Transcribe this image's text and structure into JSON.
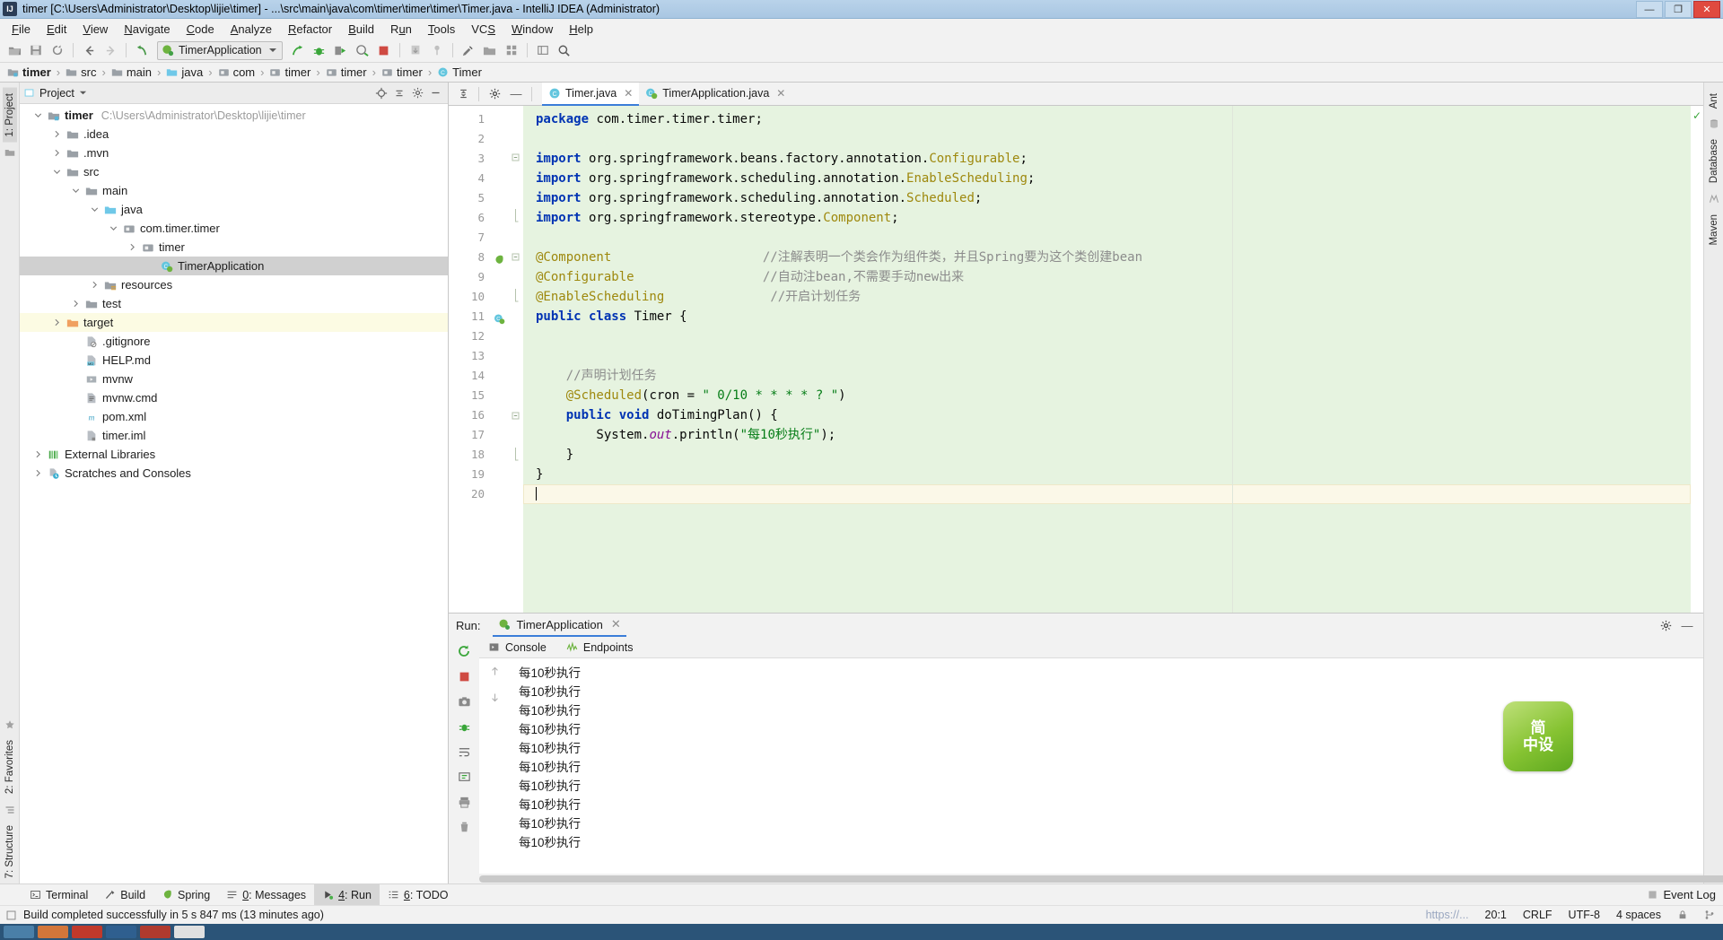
{
  "window": {
    "title": "timer [C:\\Users\\Administrator\\Desktop\\lijie\\timer] - ...\\src\\main\\java\\com\\timer\\timer\\timer\\Timer.java - IntelliJ IDEA (Administrator)",
    "app_icon_label": "IJ",
    "minimize_label": "—",
    "maximize_label": "❐",
    "close_label": "✕"
  },
  "menu": {
    "items": [
      {
        "label": "File",
        "mnemonic": "F"
      },
      {
        "label": "Edit",
        "mnemonic": "E"
      },
      {
        "label": "View",
        "mnemonic": "V"
      },
      {
        "label": "Navigate",
        "mnemonic": "N"
      },
      {
        "label": "Code",
        "mnemonic": "C"
      },
      {
        "label": "Analyze",
        "mnemonic": "A"
      },
      {
        "label": "Refactor",
        "mnemonic": "R"
      },
      {
        "label": "Build",
        "mnemonic": "B"
      },
      {
        "label": "Run",
        "mnemonic": "u"
      },
      {
        "label": "Tools",
        "mnemonic": "T"
      },
      {
        "label": "VCS",
        "mnemonic": "S"
      },
      {
        "label": "Window",
        "mnemonic": "W"
      },
      {
        "label": "Help",
        "mnemonic": "H"
      }
    ]
  },
  "toolbar": {
    "open_label": "open-folder-icon",
    "save_label": "save-icon",
    "sync_label": "sync-icon",
    "back_label": "back-arrow-icon",
    "forward_label": "forward-arrow-icon",
    "revert_label": "revert-icon",
    "run_config_name": "TimerApplication",
    "run_label": "run-icon",
    "debug_label": "debug-icon",
    "run_coverage_label": "run-with-coverage-icon",
    "profile_label": "profile-icon",
    "stop_label": "stop-icon",
    "update_project_label": "update-project-icon",
    "commit_label": "commit-icon",
    "settings_label": "settings-icon",
    "project_structure_label": "project-structure-icon",
    "search_label": "search-icon"
  },
  "breadcrumb": {
    "items": [
      {
        "label": "timer",
        "icon": "module-folder-icon",
        "bold": true
      },
      {
        "label": "src",
        "icon": "folder-icon",
        "bold": false
      },
      {
        "label": "main",
        "icon": "folder-icon",
        "bold": false
      },
      {
        "label": "java",
        "icon": "source-root-icon",
        "bold": false
      },
      {
        "label": "com",
        "icon": "package-icon",
        "bold": false
      },
      {
        "label": "timer",
        "icon": "package-icon",
        "bold": false
      },
      {
        "label": "timer",
        "icon": "package-icon",
        "bold": false
      },
      {
        "label": "timer",
        "icon": "package-icon",
        "bold": false
      },
      {
        "label": "Timer",
        "icon": "class-icon",
        "bold": false
      }
    ],
    "separator": "›"
  },
  "left_strip": {
    "project_tab": "1: Project",
    "structure_tab": "7: Structure",
    "favorites_tab": "2: Favorites"
  },
  "right_strip": {
    "ant_tab": "Ant",
    "database_tab": "Database",
    "maven_tab": "Maven"
  },
  "project_panel": {
    "title": "Project",
    "tree": [
      {
        "indent": 0,
        "arrow": "down",
        "icon": "project-folder-icon",
        "label": "timer",
        "bold": true,
        "path": "C:\\Users\\Administrator\\Desktop\\lijie\\timer",
        "state": "normal"
      },
      {
        "indent": 1,
        "arrow": "right",
        "icon": "folder-icon",
        "label": ".idea",
        "bold": false,
        "path": "",
        "state": "normal"
      },
      {
        "indent": 1,
        "arrow": "right",
        "icon": "folder-icon",
        "label": ".mvn",
        "bold": false,
        "path": "",
        "state": "normal"
      },
      {
        "indent": 1,
        "arrow": "down",
        "icon": "folder-icon",
        "label": "src",
        "bold": false,
        "path": "",
        "state": "normal"
      },
      {
        "indent": 2,
        "arrow": "down",
        "icon": "folder-icon",
        "label": "main",
        "bold": false,
        "path": "",
        "state": "normal"
      },
      {
        "indent": 3,
        "arrow": "down",
        "icon": "source-root-icon",
        "label": "java",
        "bold": false,
        "path": "",
        "state": "normal"
      },
      {
        "indent": 4,
        "arrow": "down",
        "icon": "package-icon",
        "label": "com.timer.timer",
        "bold": false,
        "path": "",
        "state": "normal"
      },
      {
        "indent": 5,
        "arrow": "right",
        "icon": "package-icon",
        "label": "timer",
        "bold": false,
        "path": "",
        "state": "normal"
      },
      {
        "indent": 6,
        "arrow": "none",
        "icon": "spring-class-icon",
        "label": "TimerApplication",
        "bold": false,
        "path": "",
        "state": "selected"
      },
      {
        "indent": 3,
        "arrow": "right",
        "icon": "resources-folder-icon",
        "label": "resources",
        "bold": false,
        "path": "",
        "state": "normal"
      },
      {
        "indent": 2,
        "arrow": "right",
        "icon": "folder-icon",
        "label": "test",
        "bold": false,
        "path": "",
        "state": "normal"
      },
      {
        "indent": 1,
        "arrow": "right",
        "icon": "target-folder-icon",
        "label": "target",
        "bold": false,
        "path": "",
        "state": "highlighted"
      },
      {
        "indent": 2,
        "arrow": "none",
        "icon": "gitignore-file-icon",
        "label": ".gitignore",
        "bold": false,
        "path": "",
        "state": "normal"
      },
      {
        "indent": 2,
        "arrow": "none",
        "icon": "markdown-file-icon",
        "label": "HELP.md",
        "bold": false,
        "path": "",
        "state": "normal"
      },
      {
        "indent": 2,
        "arrow": "none",
        "icon": "script-file-icon",
        "label": "mvnw",
        "bold": false,
        "path": "",
        "state": "normal"
      },
      {
        "indent": 2,
        "arrow": "none",
        "icon": "cmd-file-icon",
        "label": "mvnw.cmd",
        "bold": false,
        "path": "",
        "state": "normal"
      },
      {
        "indent": 2,
        "arrow": "none",
        "icon": "maven-file-icon",
        "label": "pom.xml",
        "bold": false,
        "path": "",
        "state": "normal"
      },
      {
        "indent": 2,
        "arrow": "none",
        "icon": "iml-file-icon",
        "label": "timer.iml",
        "bold": false,
        "path": "",
        "state": "normal"
      },
      {
        "indent": 0,
        "arrow": "right",
        "icon": "libraries-icon",
        "label": "External Libraries",
        "bold": false,
        "path": "",
        "state": "normal"
      },
      {
        "indent": 0,
        "arrow": "right",
        "icon": "scratches-icon",
        "label": "Scratches and Consoles",
        "bold": false,
        "path": "",
        "state": "normal"
      }
    ]
  },
  "editor": {
    "tabs": [
      {
        "label": "Timer.java",
        "icon": "java-class-icon",
        "active": true,
        "close": "✕"
      },
      {
        "label": "TimerApplication.java",
        "icon": "spring-class-icon",
        "active": false,
        "close": "✕"
      }
    ],
    "expand_all_label": "collapse-icon",
    "settings_label": "gear-icon",
    "hide_label": "—",
    "inspection_ok": "✓",
    "lines": [
      {
        "n": 1,
        "tokens": [
          {
            "t": "kw",
            "v": "package"
          },
          {
            "t": "plain",
            "v": " com.timer.timer.timer;"
          }
        ]
      },
      {
        "n": 2,
        "tokens": []
      },
      {
        "n": 3,
        "tokens": [
          {
            "t": "kw",
            "v": "import"
          },
          {
            "t": "plain",
            "v": " org.springframework.beans.factory.annotation."
          },
          {
            "t": "cls",
            "v": "Configurable"
          },
          {
            "t": "plain",
            "v": ";"
          }
        ],
        "fold": "start"
      },
      {
        "n": 4,
        "tokens": [
          {
            "t": "kw",
            "v": "import"
          },
          {
            "t": "plain",
            "v": " org.springframework.scheduling.annotation."
          },
          {
            "t": "cls",
            "v": "EnableScheduling"
          },
          {
            "t": "plain",
            "v": ";"
          }
        ]
      },
      {
        "n": 5,
        "tokens": [
          {
            "t": "kw",
            "v": "import"
          },
          {
            "t": "plain",
            "v": " org.springframework.scheduling.annotation."
          },
          {
            "t": "cls",
            "v": "Scheduled"
          },
          {
            "t": "plain",
            "v": ";"
          }
        ]
      },
      {
        "n": 6,
        "tokens": [
          {
            "t": "kw",
            "v": "import"
          },
          {
            "t": "plain",
            "v": " org.springframework.stereotype."
          },
          {
            "t": "cls",
            "v": "Component"
          },
          {
            "t": "plain",
            "v": ";"
          }
        ],
        "fold": "end"
      },
      {
        "n": 7,
        "tokens": []
      },
      {
        "n": 8,
        "tokens": [
          {
            "t": "ann",
            "v": "@Component"
          },
          {
            "t": "plain",
            "v": "                    "
          },
          {
            "t": "cmt",
            "v": "//注解表明一个类会作为组件类，并且Spring要为这个类创建bean"
          }
        ],
        "gutter": "spring-bean-icon",
        "fold": "start"
      },
      {
        "n": 9,
        "tokens": [
          {
            "t": "ann",
            "v": "@Configurable"
          },
          {
            "t": "plain",
            "v": "                 "
          },
          {
            "t": "cmt",
            "v": "//自动注bean,不需要手动new出来"
          }
        ]
      },
      {
        "n": 10,
        "tokens": [
          {
            "t": "ann",
            "v": "@EnableScheduling"
          },
          {
            "t": "plain",
            "v": "              "
          },
          {
            "t": "cmt",
            "v": "//开启计划任务"
          }
        ],
        "fold": "end"
      },
      {
        "n": 11,
        "tokens": [
          {
            "t": "kw",
            "v": "public class"
          },
          {
            "t": "plain",
            "v": " Timer {"
          }
        ],
        "gutter": "spring-class-icon"
      },
      {
        "n": 12,
        "tokens": []
      },
      {
        "n": 13,
        "tokens": []
      },
      {
        "n": 14,
        "tokens": [
          {
            "t": "plain",
            "v": "    "
          },
          {
            "t": "cmt",
            "v": "//声明计划任务"
          }
        ]
      },
      {
        "n": 15,
        "tokens": [
          {
            "t": "plain",
            "v": "    "
          },
          {
            "t": "ann",
            "v": "@Scheduled"
          },
          {
            "t": "plain",
            "v": "(cron = "
          },
          {
            "t": "str",
            "v": "\" 0/10 * * * * ? \""
          },
          {
            "t": "plain",
            "v": ")"
          }
        ]
      },
      {
        "n": 16,
        "tokens": [
          {
            "t": "plain",
            "v": "    "
          },
          {
            "t": "kw",
            "v": "public void"
          },
          {
            "t": "plain",
            "v": " doTimingPlan() {"
          }
        ],
        "fold": "start"
      },
      {
        "n": 17,
        "tokens": [
          {
            "t": "plain",
            "v": "        System."
          },
          {
            "t": "fld",
            "v": "out"
          },
          {
            "t": "plain",
            "v": ".println("
          },
          {
            "t": "str",
            "v": "\"每10秒执行\""
          },
          {
            "t": "plain",
            "v": ");"
          }
        ]
      },
      {
        "n": 18,
        "tokens": [
          {
            "t": "plain",
            "v": "    }"
          }
        ],
        "fold": "end"
      },
      {
        "n": 19,
        "tokens": [
          {
            "t": "plain",
            "v": "}"
          }
        ]
      },
      {
        "n": 20,
        "tokens": [],
        "current": true
      }
    ]
  },
  "run_window": {
    "label": "Run:",
    "tab_label": "TimerApplication",
    "tab_close": "✕",
    "settings_icon": "gear-icon",
    "hide_icon": "—",
    "subtabs": [
      {
        "label": "Console",
        "icon": "console-icon"
      },
      {
        "label": "Endpoints",
        "icon": "endpoints-icon"
      }
    ],
    "side_buttons": [
      "rerun-icon",
      "stop-icon",
      "screenshot-icon",
      "thread-dump-icon",
      "wrap-text-icon",
      "scroll-to-end-icon",
      "print-icon",
      "clear-all-icon"
    ],
    "console_lines": [
      "每10秒执行",
      "每10秒执行",
      "每10秒执行",
      "每10秒执行",
      "每10秒执行",
      "每10秒执行",
      "每10秒执行",
      "每10秒执行",
      "每10秒执行",
      "每10秒执行"
    ],
    "watermark_line1": "简",
    "watermark_line2": "中设"
  },
  "tool_window_bar": {
    "items": [
      {
        "label": "Terminal",
        "icon": "terminal-icon",
        "mnemonic": "",
        "active": false
      },
      {
        "label": "Build",
        "icon": "build-icon",
        "mnemonic": "",
        "active": false
      },
      {
        "label": "Spring",
        "icon": "spring-icon",
        "mnemonic": "",
        "active": false
      },
      {
        "label": "0: Messages",
        "icon": "messages-icon",
        "mnemonic": "0",
        "active": false
      },
      {
        "label": "4: Run",
        "icon": "run-icon",
        "mnemonic": "4",
        "active": true
      },
      {
        "label": "6: TODO",
        "icon": "todo-icon",
        "mnemonic": "6",
        "active": false
      }
    ],
    "event_log": "Event Log"
  },
  "status_bar": {
    "message": "Build completed successfully in 5 s 847 ms (13 minutes ago)",
    "url_hint": "https://...",
    "caret_position": "20:1",
    "line_separator": "CRLF",
    "encoding": "UTF-8",
    "indent": "4 spaces",
    "lock_icon": "lock-icon",
    "branch_icon": "git-branch-icon"
  },
  "colors": {
    "accent_blue": "#3b7dd8",
    "title_bar": "#a9c6e2",
    "editor_changed_bg": "#e6f3e0",
    "current_line_bg": "#fbf8e8",
    "selection_gray": "#d0d0d0",
    "highlight_yellow": "#fcfbe3",
    "keyword": "#0033b3",
    "string": "#067d17",
    "comment": "#8c8c8c",
    "annotation": "#9e880d",
    "close_red": "#e04a3f"
  }
}
